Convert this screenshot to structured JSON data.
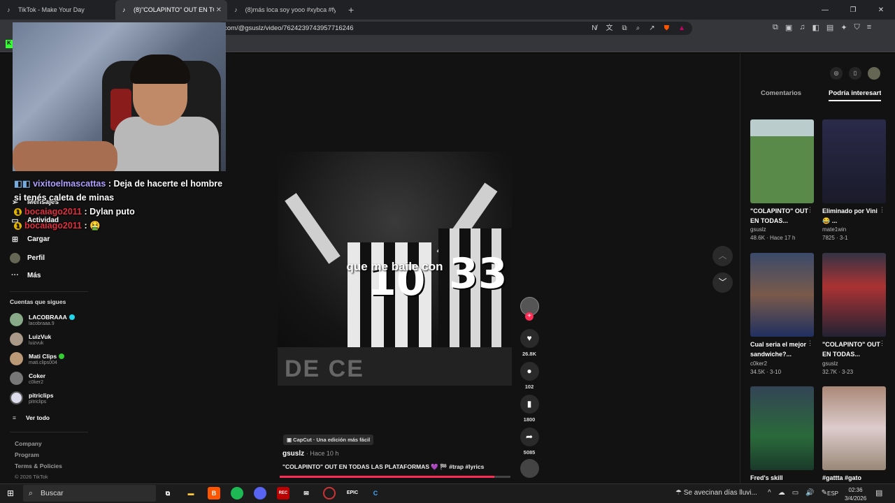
{
  "browser": {
    "tabs": [
      {
        "title": "TikTok - Make Your Day",
        "active": false
      },
      {
        "title": "(8)\"COLAPINTO\" OUT EN TODAS",
        "active": true
      },
      {
        "title": "(8)más loca soy yooo #xybca #fyp | s",
        "active": false
      }
    ],
    "url": "com/@gsuslz/video/7624239743957716246"
  },
  "sidebar": {
    "items": [
      {
        "label": "Mensajes",
        "icon": "send-icon"
      },
      {
        "label": "Actividad",
        "icon": "inbox-icon"
      },
      {
        "label": "Cargar",
        "icon": "plus-square-icon"
      },
      {
        "label": "Perfil",
        "icon": "profile-icon"
      },
      {
        "label": "Más",
        "icon": "more-icon"
      }
    ],
    "following_title": "Cuentas que sigues",
    "accounts": [
      {
        "name": "LACOBRAAA",
        "handle": "lacobraaa.9"
      },
      {
        "name": "LuizVuk",
        "handle": "luizvuk"
      },
      {
        "name": "Mati Clips",
        "handle": "mati.clips004"
      },
      {
        "name": "Coker",
        "handle": "c0ker2"
      },
      {
        "name": "pitriclips",
        "handle": "pitriclips"
      }
    ],
    "see_all": "Ver todo",
    "footer": [
      "Company",
      "Program",
      "Terms & Policies"
    ],
    "copyright": "© 2026 TikTok"
  },
  "chat": {
    "messages": [
      {
        "user": "vixitoelmascattas",
        "text": ": Deja de hacerte el hombre si tenés caleta de minas"
      },
      {
        "user": "bocaiago2011",
        "text": ": Dylan puto"
      },
      {
        "user": "bocaiago2011",
        "text": ": 🤮"
      }
    ],
    "badge": "1"
  },
  "video": {
    "caption_overlay": "que me baile con",
    "jersey_numbers": [
      "10",
      "33"
    ],
    "capcut": "CapCut · Una edición más fácil",
    "username": "gsuslz",
    "time": "· Hace 10 h",
    "description": "\"COLAPINTO\" OUT EN TODAS LAS PLATAFORMAS 💜 🏁 #trap #lyrics",
    "progress": 0.93,
    "likes": "26.8K",
    "comments": "102",
    "saves": "1800",
    "shares": "5085"
  },
  "right_panel": {
    "tabs": [
      "Comentarios",
      "Podría interesarte"
    ],
    "items": [
      {
        "title": "\"COLAPINTO\" OUT EN TODAS...",
        "user": "gsuslz",
        "stats": "48.6K · Hace 17 h"
      },
      {
        "title": "Eliminado por Vini 😂 ...",
        "user": "mate1win",
        "stats": "7825 · 3-1"
      },
      {
        "title": "Cual seria el mejor sandwiche?...",
        "user": "c0ker2",
        "stats": "34.5K · 3-10"
      },
      {
        "title": "\"COLAPINTO\" OUT EN TODAS...",
        "user": "gsuslz",
        "stats": "32.7K · 3-23"
      },
      {
        "title": "Fred's skill",
        "user": "",
        "stats": ""
      },
      {
        "title": "#gattta #gato",
        "user": "",
        "stats": ""
      }
    ]
  },
  "taskbar": {
    "search": "Buscar",
    "weather": "Se avecinan días lluvi...",
    "lang": "ESP",
    "time": "02:36",
    "date": "3/4/2026"
  }
}
